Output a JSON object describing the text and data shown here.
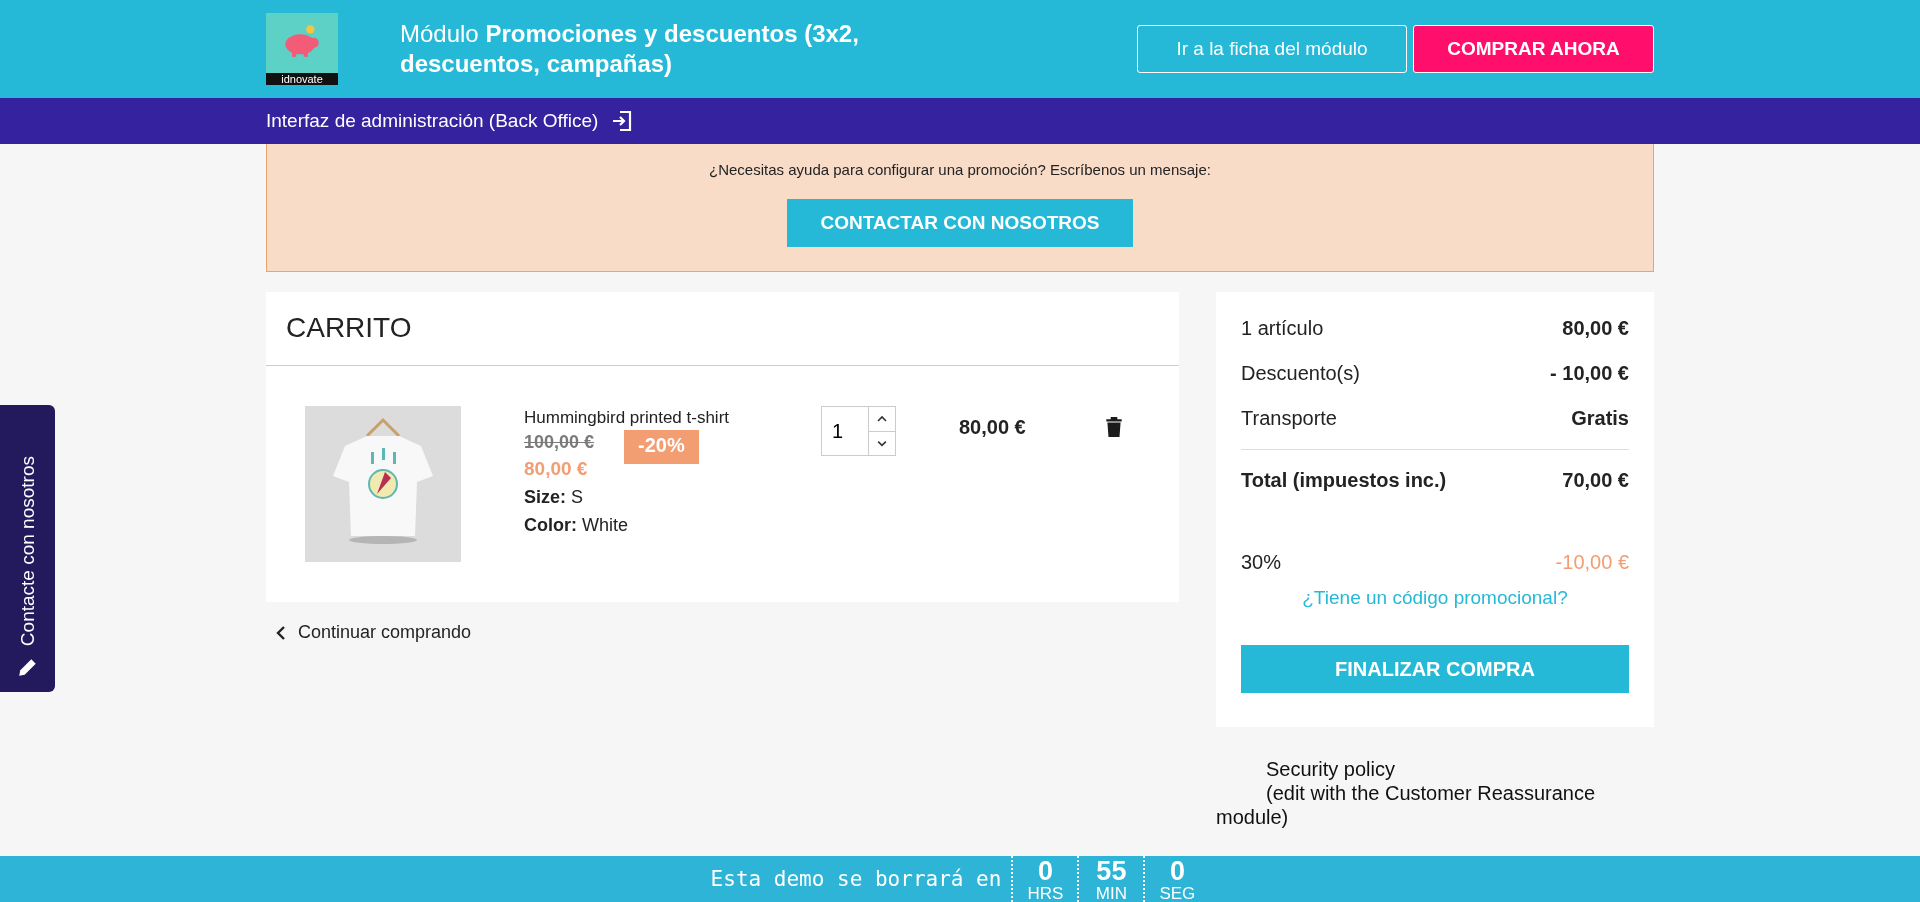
{
  "header": {
    "title_prefix": "Módulo",
    "title_bold": "Promociones y descuentos (3x2, descuentos, campañas)",
    "logo_text": "idnovate",
    "buttons": [
      {
        "label": "Ir a la ficha del módulo",
        "kind": "outline"
      },
      {
        "label": "COMPRAR AHORA",
        "kind": "primary"
      }
    ]
  },
  "admin_bar": {
    "label": "Interfaz de administración (Back Office)"
  },
  "help_box": {
    "text": "¿Necesitas ayuda para configurar una promoción? Escríbenos un mensaje:",
    "button": "CONTACTAR CON NOSOTROS"
  },
  "side_tab": {
    "label": "Contacte con nosotros"
  },
  "cart": {
    "title": "CARRITO",
    "items": [
      {
        "name": "Hummingbird printed t-shirt",
        "regular_price": "100,00 €",
        "discount": "-20%",
        "price": "80,00 €",
        "attributes": [
          {
            "label": "Size:",
            "value": "S"
          },
          {
            "label": "Color:",
            "value": "White"
          }
        ],
        "quantity": "1",
        "total": "80,00 €"
      }
    ],
    "continue_link": "Continuar comprando"
  },
  "summary": {
    "lines": [
      {
        "label": "1 artículo",
        "value": "80,00 €",
        "kind": "line"
      },
      {
        "label": "Descuento(s)",
        "value": "- 10,00 €",
        "kind": "line"
      },
      {
        "label": "Transporte",
        "value": "Gratis",
        "kind": "line"
      },
      {
        "label": "Total (impuestos inc.)",
        "value": "70,00 €",
        "kind": "total"
      },
      {
        "label": "30%",
        "value": "-10,00 €",
        "kind": "promo"
      }
    ],
    "promo_link": "¿Tiene un código promocional?",
    "checkout_button": "FINALIZAR COMPRA"
  },
  "reassurance": {
    "title": "Security policy",
    "text": "(edit with the Customer Reassurance module)"
  },
  "footer": {
    "text": "Esta demo se borrará en",
    "units": [
      {
        "value": "0",
        "label": "HRS"
      },
      {
        "value": "55",
        "label": "MIN"
      },
      {
        "value": "0",
        "label": "SEG"
      }
    ]
  }
}
